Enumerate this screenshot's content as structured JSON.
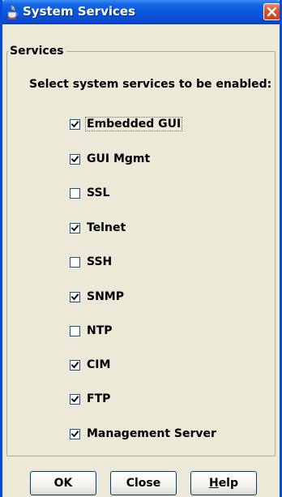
{
  "window": {
    "title": "System Services",
    "title_icon": "java-cup-icon",
    "close_icon": "close-icon",
    "colors": {
      "titlebar": "#0a55d8",
      "close_button": "#e2542d",
      "background": "#ece9d8"
    }
  },
  "group": {
    "legend": "Services",
    "instruction": "Select system services to be enabled:"
  },
  "services": [
    {
      "label": "Embedded GUI",
      "checked": true,
      "focused": true
    },
    {
      "label": "GUI Mgmt",
      "checked": true,
      "focused": false
    },
    {
      "label": "SSL",
      "checked": false,
      "focused": false
    },
    {
      "label": "Telnet",
      "checked": true,
      "focused": false
    },
    {
      "label": "SSH",
      "checked": false,
      "focused": false
    },
    {
      "label": "SNMP",
      "checked": true,
      "focused": false
    },
    {
      "label": "NTP",
      "checked": false,
      "focused": false
    },
    {
      "label": "CIM",
      "checked": true,
      "focused": false
    },
    {
      "label": "FTP",
      "checked": true,
      "focused": false
    },
    {
      "label": "Management Server",
      "checked": true,
      "focused": false
    }
  ],
  "buttons": {
    "ok": "OK",
    "close": "Close",
    "help_mnemonic": "H",
    "help_rest": "elp"
  }
}
